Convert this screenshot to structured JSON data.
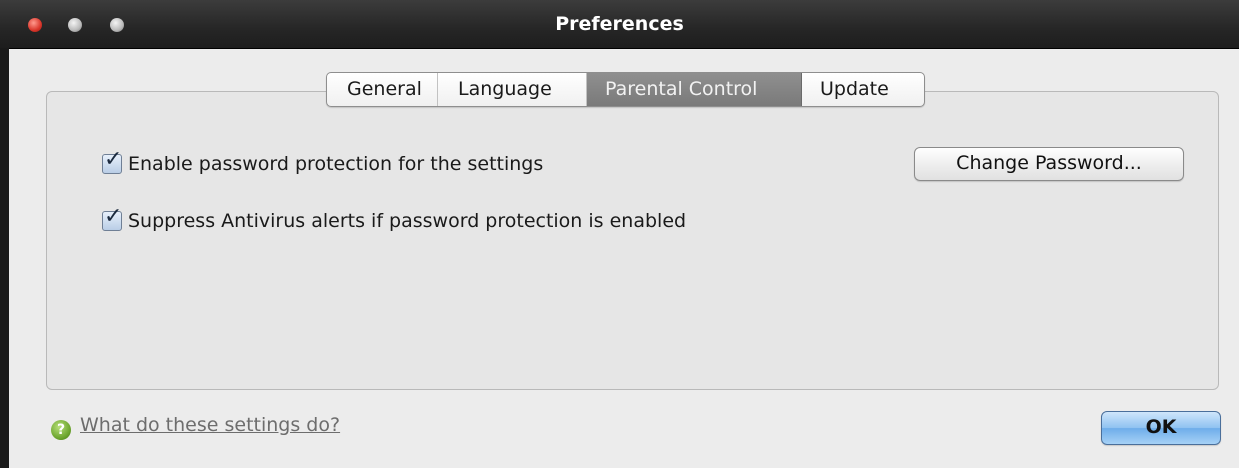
{
  "window": {
    "title": "Preferences"
  },
  "tabs": [
    {
      "label": "General",
      "active": false
    },
    {
      "label": "Language",
      "active": false
    },
    {
      "label": "Parental Control",
      "active": true
    },
    {
      "label": "Update",
      "active": false
    }
  ],
  "settings": {
    "enable_password": {
      "label": "Enable password protection for the settings",
      "checked": true
    },
    "suppress_alerts": {
      "label": "Suppress Antivirus alerts if password protection is enabled",
      "checked": true
    },
    "change_password_label": "Change Password..."
  },
  "footer": {
    "help_link": "What do these settings do?",
    "ok_label": "OK"
  },
  "colors": {
    "titlebar": "#262626",
    "active_tab": "#7f7f7f",
    "ok_button": "#8fc2f1",
    "help_icon": "#6aa32c"
  },
  "icons": {
    "help": "question-mark-icon",
    "check": "checkmark-icon"
  }
}
